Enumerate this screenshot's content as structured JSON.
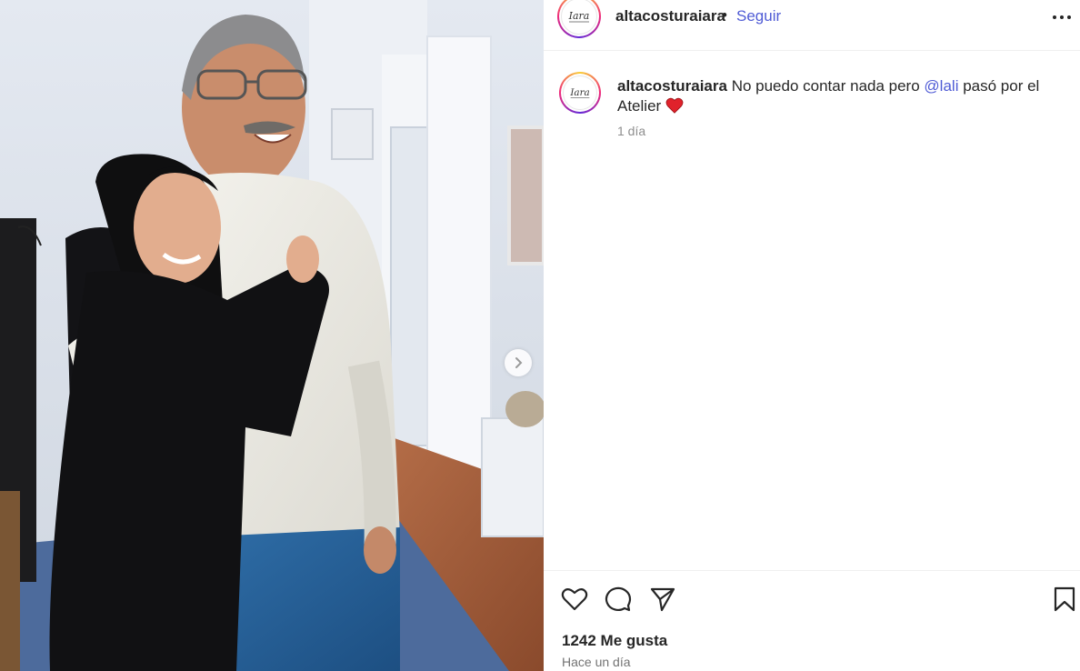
{
  "post": {
    "username": "altacosturaiara",
    "separator": "•",
    "follow_label": "Seguir",
    "avatar_logo_text": "Iara",
    "caption": {
      "username": "altacosturaiara",
      "text_before": "No puedo contar nada pero",
      "mention": "@lali",
      "text_after": "pasó por el Atelier",
      "emoji": "❤️"
    },
    "caption_time": "1 día",
    "likes": "1242 Me gusta",
    "date": "Hace un día"
  },
  "icons": {
    "more": "more-options-icon",
    "like": "heart-icon",
    "comment": "comment-icon",
    "share": "share-icon",
    "save": "bookmark-icon",
    "carousel": "chevron-right-icon"
  },
  "colors": {
    "link": "#4f5bd5",
    "text": "#262626",
    "muted": "#8e8e8e"
  }
}
